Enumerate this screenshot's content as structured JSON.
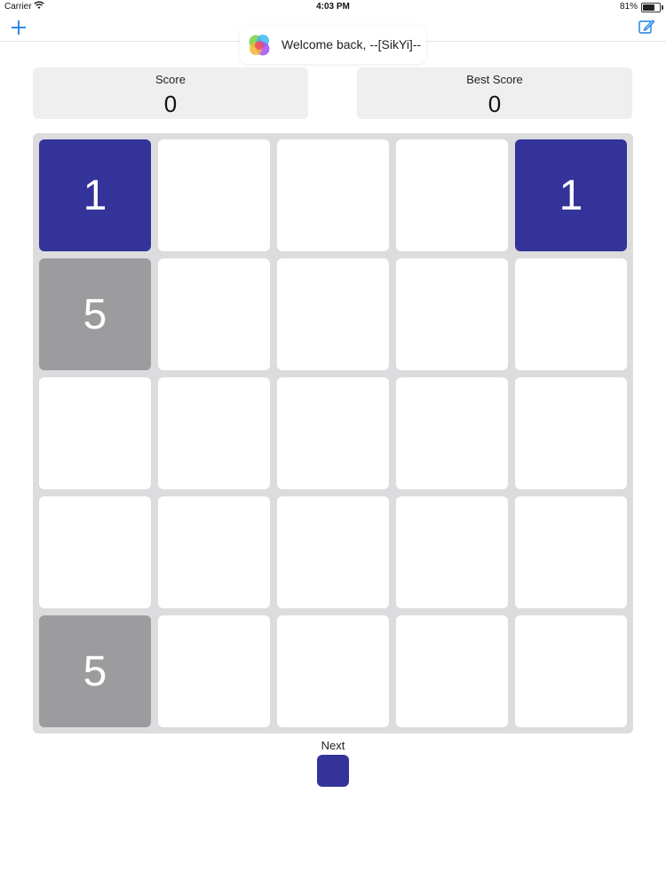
{
  "status_bar": {
    "carrier": "Carrier",
    "time": "4:03 PM",
    "battery": "81%",
    "battery_level": 0.81
  },
  "nav": {
    "add_icon": "plus-icon",
    "compose_icon": "compose-icon",
    "accent_color": "#1a7ee6"
  },
  "game_center": {
    "message": "Welcome back, --[SikYi]--",
    "icon": "game-center-icon"
  },
  "score": {
    "label": "Score",
    "value": "0"
  },
  "best_score": {
    "label": "Best Score",
    "value": "0"
  },
  "board": {
    "rows": 5,
    "cols": 5,
    "tiles": [
      [
        "1",
        "",
        "",
        "",
        "1"
      ],
      [
        "5",
        "",
        "",
        "",
        ""
      ],
      [
        "",
        "",
        "",
        "",
        ""
      ],
      [
        "",
        "",
        "",
        "",
        ""
      ],
      [
        "5",
        "",
        "",
        "",
        ""
      ]
    ],
    "tile_colors": {
      "1": "#333399",
      "5": "#9c9c9e",
      "empty": "#ffffff"
    },
    "board_color": "#dcdcde"
  },
  "next": {
    "label": "Next",
    "tile_value": "1"
  }
}
